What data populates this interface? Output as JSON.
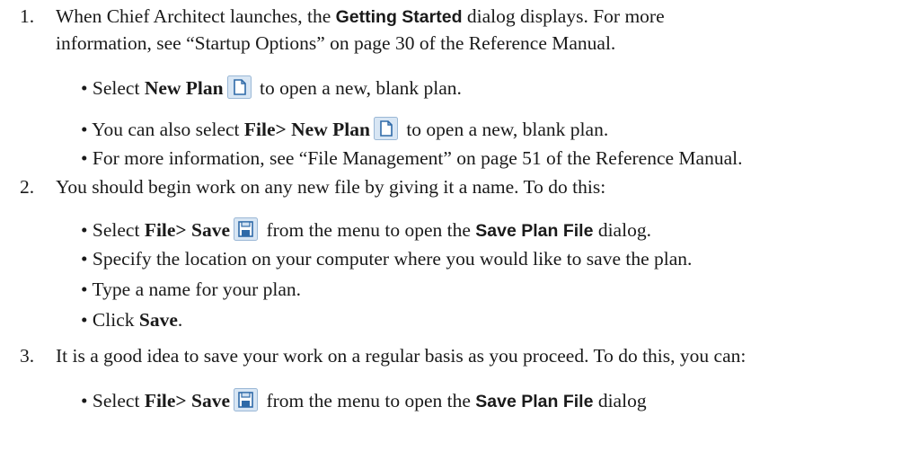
{
  "step1": {
    "number": "1.",
    "line1_pre": "When Chief Architect launches, the ",
    "line1_bold": "Getting Started",
    "line1_post": " dialog displays. For more",
    "line2": "information, see “Startup Options” on page 30 of the Reference Manual.",
    "bullets": [
      {
        "pre": "• Select ",
        "bold": "New Plan",
        "icon": "new-plan-icon",
        "post": " to open a new, blank plan."
      },
      {
        "pre": "• You can also select ",
        "bold": "File> New Plan",
        "icon": "new-plan-icon",
        "post": " to open a new, blank plan."
      },
      {
        "text": "• For more information, see “File Management” on page 51 of the Reference Manual."
      }
    ]
  },
  "step2": {
    "number": "2.",
    "line1": "You should begin work on any new file by giving it a name. To do this:",
    "bullets": [
      {
        "pre": "• Select ",
        "bold": "File> Save",
        "icon": "save-icon",
        "mid": " from the menu to open the ",
        "sansbold": "Save Plan File",
        "post": " dialog."
      },
      {
        "text": "• Specify the location on your computer where you would like to save the plan."
      },
      {
        "text": "• Type a name for your plan."
      },
      {
        "pre": "• Click ",
        "bold": "Save",
        "post": "."
      }
    ]
  },
  "step3": {
    "number": "3.",
    "line1": "It is a good idea to save your work on a regular basis as you proceed. To do this, you can:",
    "bullets": [
      {
        "pre": "• Select ",
        "bold": "File> Save",
        "icon": "save-icon",
        "mid": " from the menu to open the ",
        "sansbold": "Save Plan File",
        "post": " dialog"
      }
    ]
  },
  "colors": {
    "text": "#1a1a1a",
    "icon_blue": "#3d7ab8",
    "icon_fill": "#eaf2fa"
  }
}
